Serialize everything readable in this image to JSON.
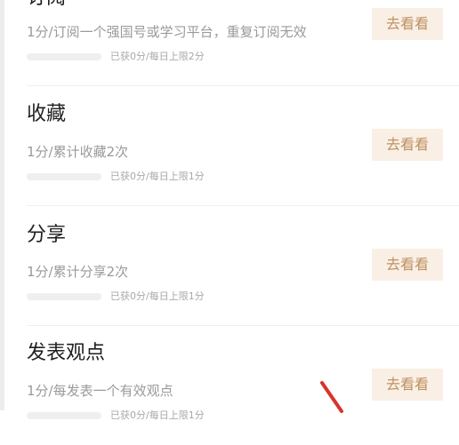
{
  "action_label": "去看看",
  "tasks": [
    {
      "title": "订阅",
      "desc": "1分/订阅一个强国号或学习平台，重复订阅无效",
      "progress_text": "已获0分/每日上限2分",
      "progress_fraction": 0
    },
    {
      "title": "收藏",
      "desc": "1分/累计收藏2次",
      "progress_text": "已获0分/每日上限1分",
      "progress_fraction": 0
    },
    {
      "title": "分享",
      "desc": "1分/累计分享2次",
      "progress_text": "已获0分/每日上限1分",
      "progress_fraction": 0
    },
    {
      "title": "发表观点",
      "desc": "1分/每发表一个有效观点",
      "progress_text": "已获0分/每日上限1分",
      "progress_fraction": 0
    }
  ],
  "colors": {
    "accent_text": "#be9162",
    "accent_bg": "#f9efe4",
    "annotation": "#d8342a"
  }
}
